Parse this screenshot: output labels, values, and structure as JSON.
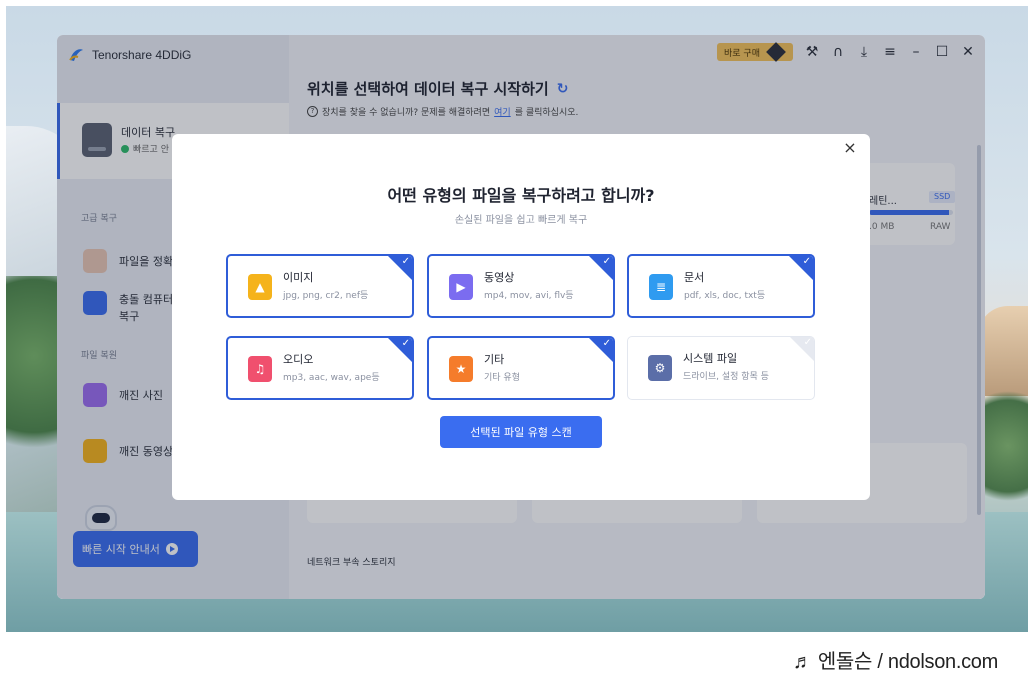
{
  "app": {
    "name": "Tenorshare 4DDiG",
    "buy_label": "바로 구매"
  },
  "sidebar": {
    "active_item": {
      "title": "데이터 복구",
      "subtitle": "빠르고 안"
    },
    "section_advanced": "고급 복구",
    "items_advanced": [
      {
        "label": "파일을 정확"
      },
      {
        "label": "충돌 컴퓨터\n복구"
      }
    ],
    "section_repair": "파일 복원",
    "items_repair": [
      {
        "label": "깨진 사진"
      },
      {
        "label": "깨진 동영상"
      }
    ],
    "quick_start_label": "빠른 시작 안내서"
  },
  "main": {
    "title": "위치를 선택하여 데이터 복구 시작하기",
    "help_prefix": "장치를 찾을 수 없습니까? 문제를 해결하려면 ",
    "help_link": "여기",
    "help_suffix": "를 클릭하십시오.",
    "drive": {
      "name": "레틴...",
      "badge": "SSD",
      "size": ".0 MB",
      "fs": "RAW",
      "usage_fraction": 0.95
    },
    "network_label": "네트워크 부속 스토리지"
  },
  "modal": {
    "title": "어떤 유형의 파일을 복구하려고 합니까?",
    "subtitle": "손실된 파일을 쉽고 빠르게 복구",
    "file_types": [
      {
        "name": "이미지",
        "desc": "jpg, png, cr2, nef등",
        "selected": true,
        "icon": "image-icon",
        "color": "#f5b31b"
      },
      {
        "name": "동영상",
        "desc": "mp4, mov, avi, flv등",
        "selected": true,
        "icon": "video-icon",
        "color": "#7b6cf0"
      },
      {
        "name": "문서",
        "desc": "pdf, xls, doc, txt등",
        "selected": true,
        "icon": "document-icon",
        "color": "#2f9bf0"
      },
      {
        "name": "오디오",
        "desc": "mp3, aac, wav, ape등",
        "selected": true,
        "icon": "audio-icon",
        "color": "#f0506e"
      },
      {
        "name": "기타",
        "desc": "기타 유형",
        "selected": true,
        "icon": "other-icon",
        "color": "#f57c2b"
      },
      {
        "name": "시스템 파일",
        "desc": "드라이브, 설정 항목 등",
        "selected": false,
        "icon": "system-file-icon",
        "color": "#5b6ea8"
      }
    ],
    "scan_button": "선택된 파일 유형 스캔"
  },
  "watermark": "♬ 엔돌슨 / ndolson.com",
  "colors": {
    "accent": "#3a6df0",
    "selected_border": "#2f5dd8"
  }
}
